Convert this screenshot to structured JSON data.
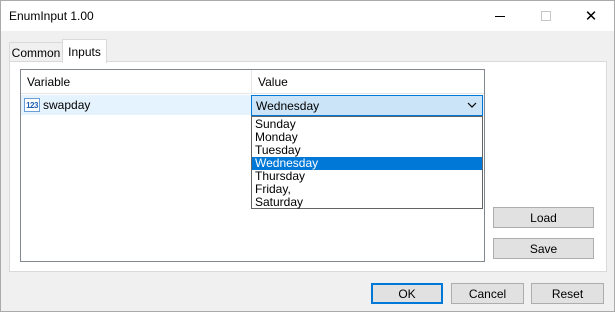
{
  "window": {
    "title": "EnumInput 1.00",
    "min_icon": "minimize-icon",
    "max_icon": "maximize-icon",
    "close_icon": "close-icon",
    "close_glyph": "✕"
  },
  "tabs": [
    {
      "label": "Common",
      "active": false
    },
    {
      "label": "Inputs",
      "active": true
    }
  ],
  "grid": {
    "headers": {
      "variable": "Variable",
      "value": "Value"
    },
    "rows": [
      {
        "icon": "numeric-type-icon",
        "icon_text": "123",
        "name": "swapday",
        "value": "Wednesday"
      }
    ]
  },
  "dropdown": {
    "options": [
      "Sunday",
      "Monday",
      "Tuesday",
      "Wednesday",
      "Thursday",
      "Friday,",
      "Saturday"
    ],
    "selected": "Wednesday"
  },
  "buttons": {
    "load": "Load",
    "save": "Save",
    "ok": "OK",
    "cancel": "Cancel",
    "reset": "Reset"
  },
  "colors": {
    "accent": "#0078d7",
    "row_highlight": "#e5f3ff",
    "combo_bg": "#cce4f7"
  }
}
